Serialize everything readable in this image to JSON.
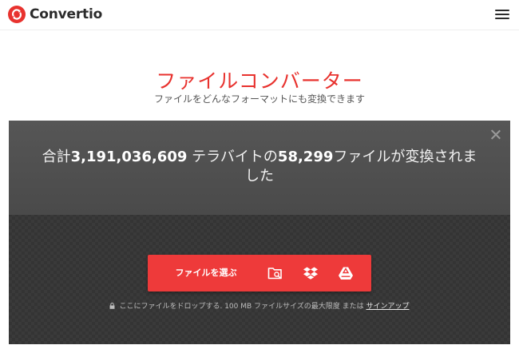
{
  "header": {
    "brand_name": "Convertio",
    "logo_icon": "convertio-logo-icon",
    "menu_icon": "hamburger-menu-icon"
  },
  "hero": {
    "title": "ファイルコンバーター",
    "subtitle": "ファイルをどんなフォーマットにも変換できます"
  },
  "panel": {
    "stat_prefix": "合計",
    "stat_terabytes": "3,191,036,609",
    "stat_middle": " テラバイトの",
    "stat_files": "58,299",
    "stat_suffix": "ファイルが変換されました",
    "close_icon": "close-icon",
    "choose_files_label": "ファイルを選ぶ",
    "source_icons": [
      "folder-search-icon",
      "dropbox-icon",
      "google-drive-icon"
    ],
    "hint_text": "ここにファイルをドロップする. 100 MB ファイルサイズの最大限度 または ",
    "signup_link": "サインアップ"
  },
  "colors": {
    "brand_red": "#e8322e",
    "button_red": "#ee3a3a",
    "panel_dark": "#3a3a3a"
  }
}
